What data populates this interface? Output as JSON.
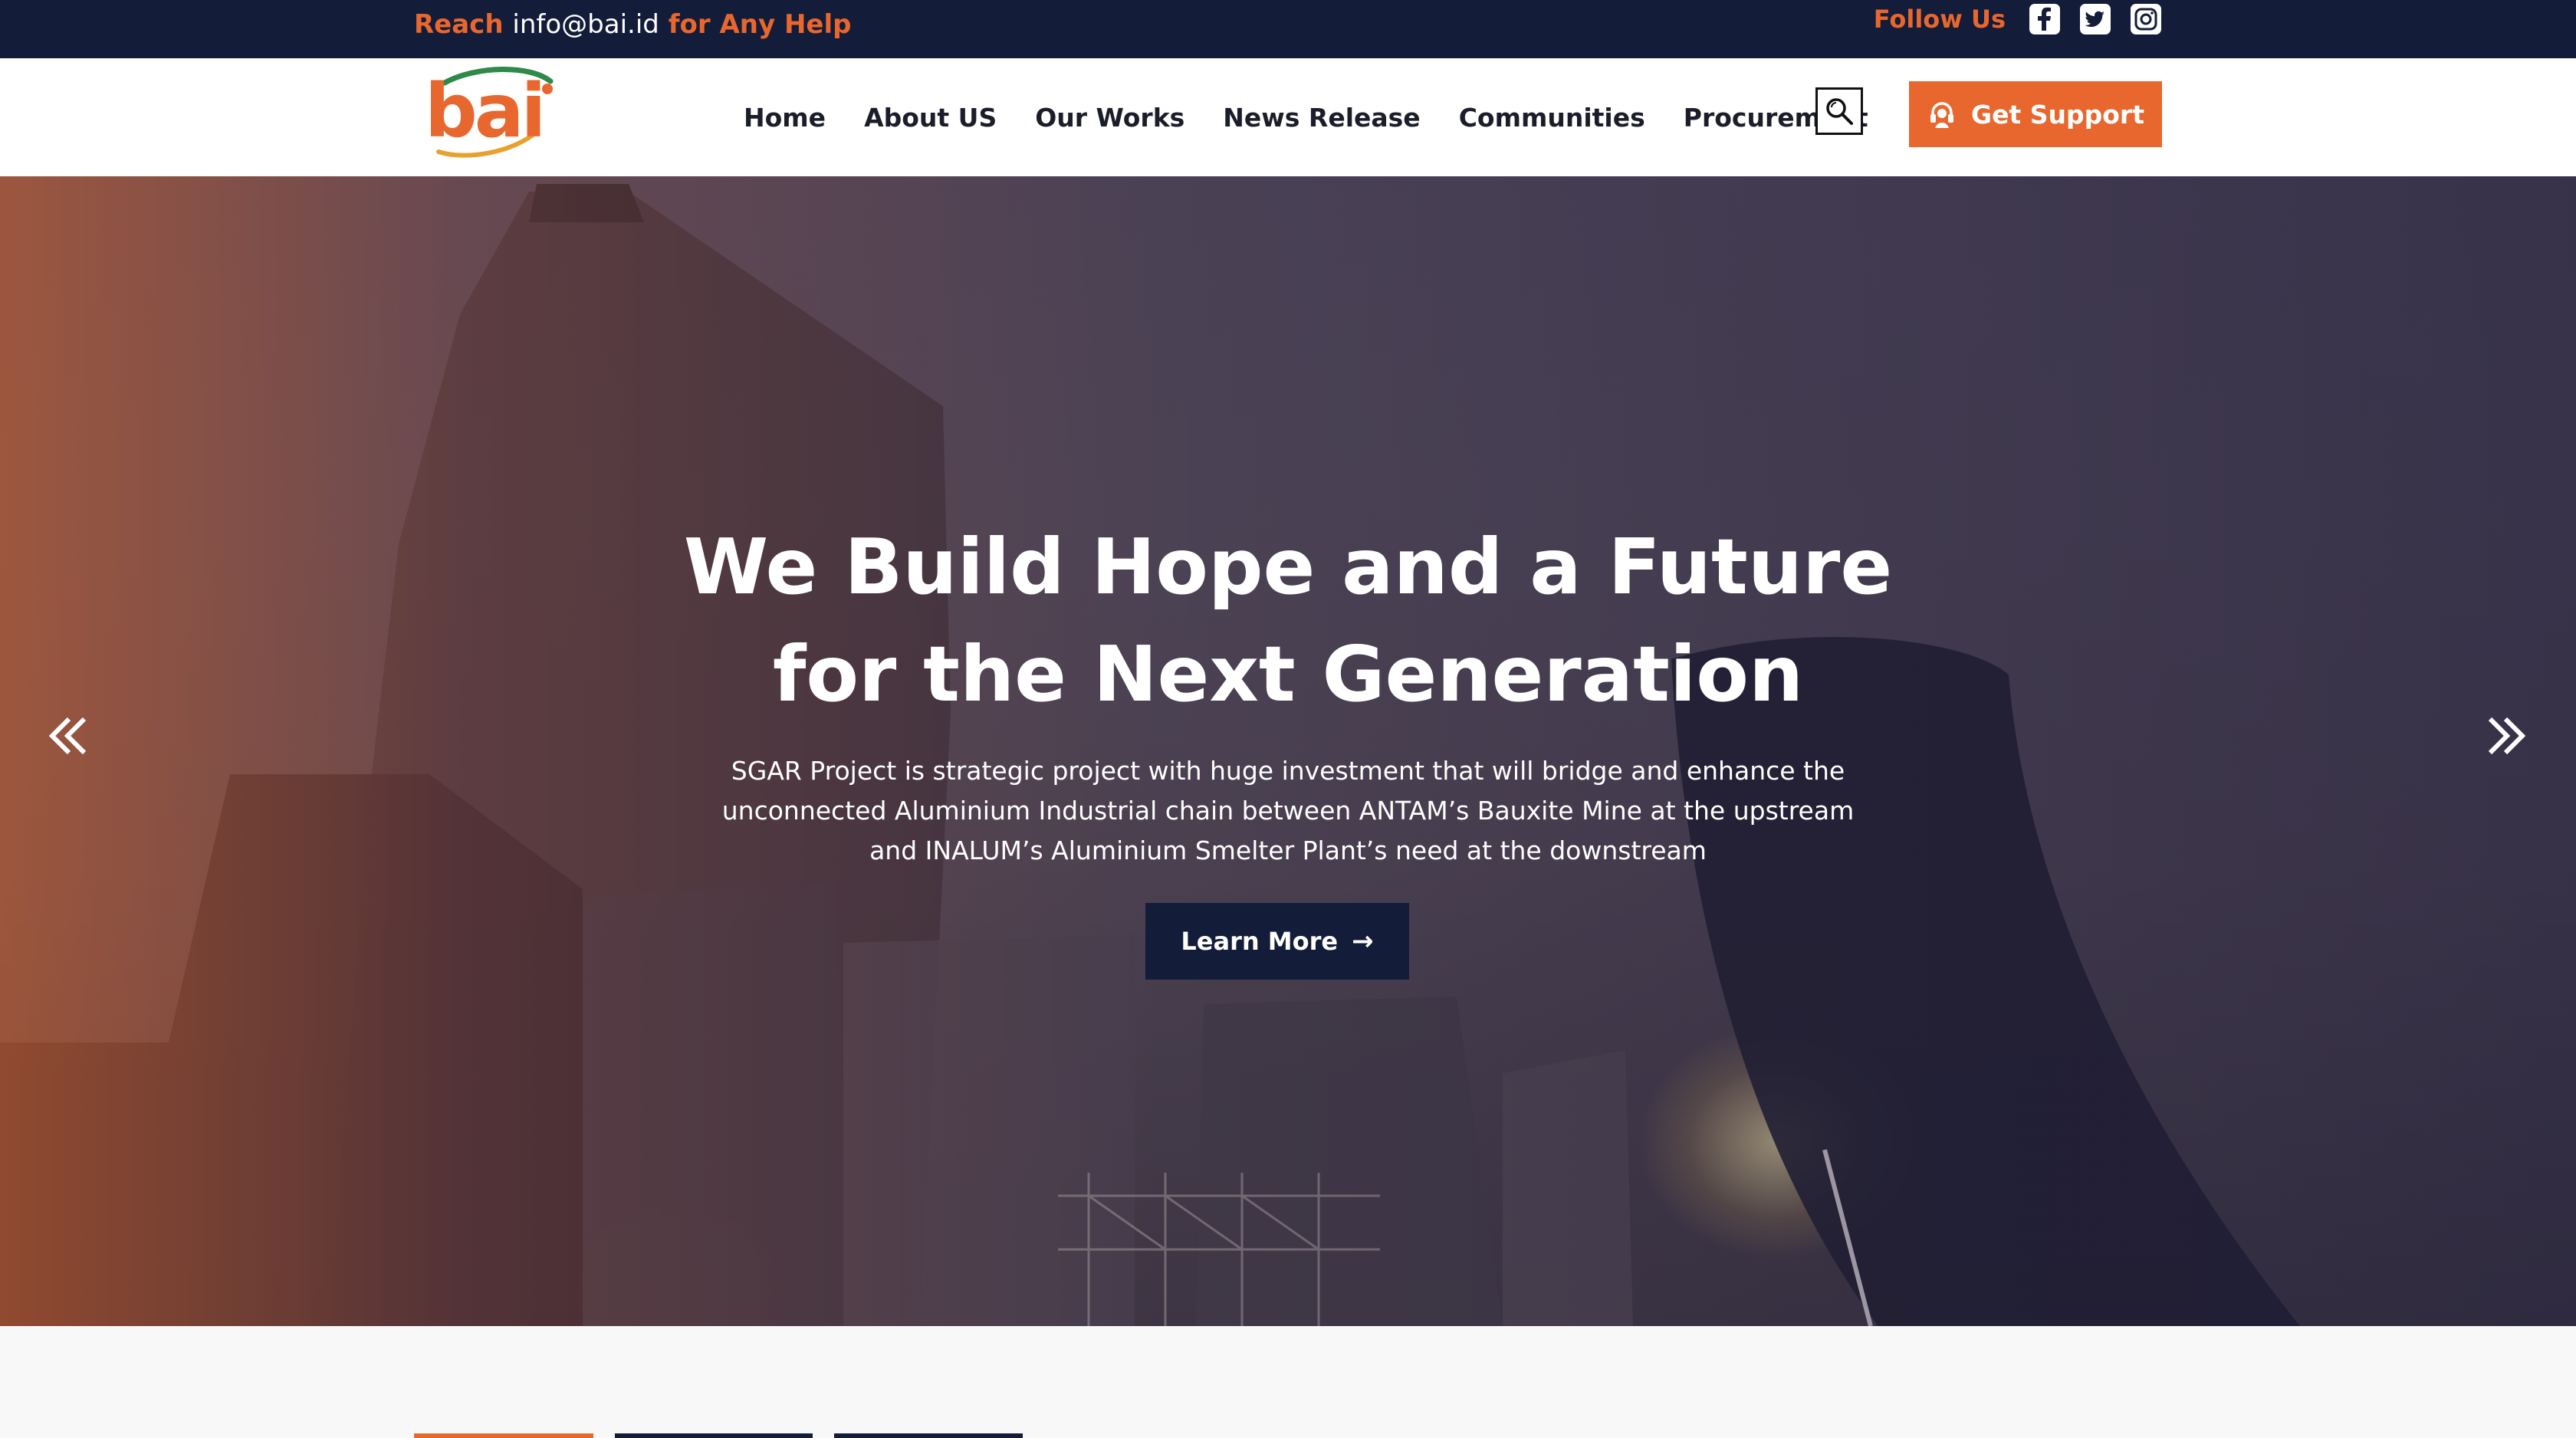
{
  "topbar": {
    "reach_prefix": "Reach",
    "email": "info@bai.id",
    "reach_suffix": "for Any Help",
    "follow_label": "Follow Us",
    "social": [
      "facebook-icon",
      "twitter-icon",
      "instagram-icon"
    ]
  },
  "header": {
    "logo_text": "bai",
    "nav": [
      "Home",
      "About US",
      "Our Works",
      "News Release",
      "Communities",
      "Procurement"
    ],
    "search_icon": "search-icon",
    "support_label": "Get Support",
    "support_icon": "headset-icon"
  },
  "hero": {
    "title_line1": "We Build Hope and a Future",
    "title_line2": "for the Next Generation",
    "desc_line1": "SGAR Project is strategic project with huge investment that will bridge and enhance the",
    "desc_line2": "unconnected Aluminium Industrial chain between ANTAM’s Bauxite Mine at the upstream",
    "desc_line3": "and INALUM’s Aluminium Smelter Plant’s need at the downstream",
    "cta_label": "Learn More",
    "cta_arrow": "→",
    "prev_icon": "double-chevron-left-icon",
    "next_icon": "double-chevron-right-icon"
  },
  "colors": {
    "accent": "#e8672e",
    "navy": "#131c38",
    "white": "#ffffff",
    "logo_green": "#2f8a4a"
  },
  "bottom_tabs": [
    {
      "color": "#e8672e"
    },
    {
      "color": "#131c38"
    },
    {
      "color": "#131c38"
    }
  ]
}
